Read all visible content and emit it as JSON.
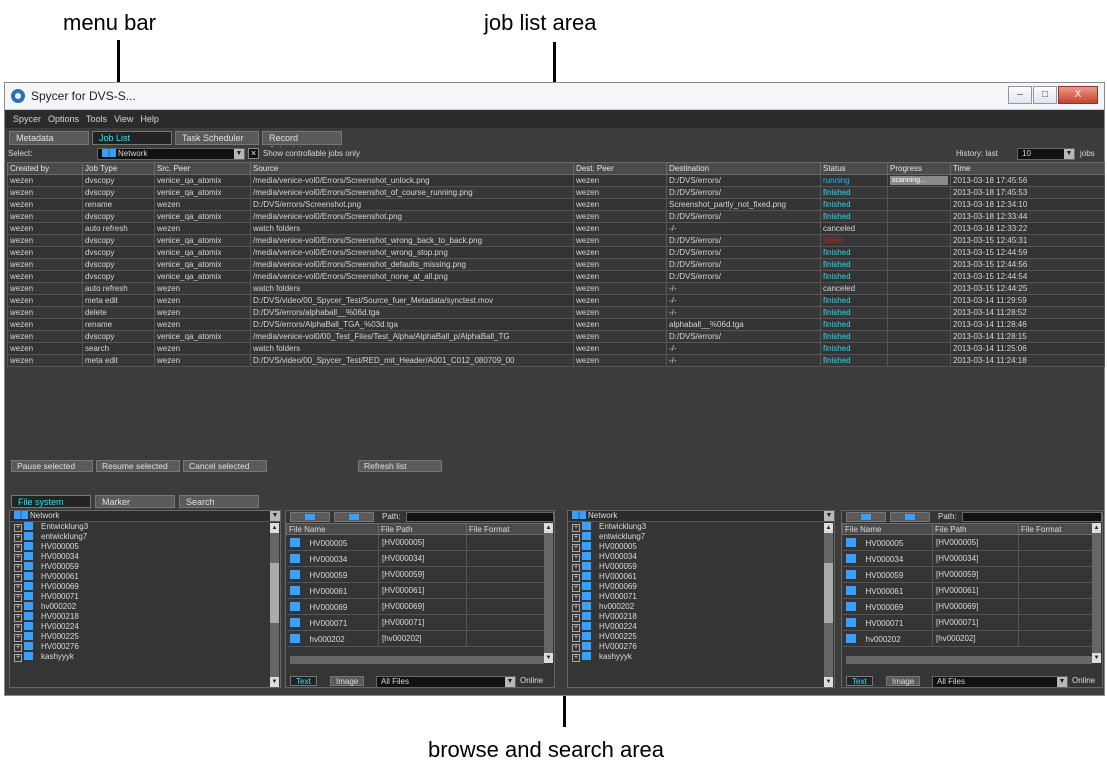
{
  "annotations": {
    "menu_bar": "menu bar",
    "job_list_area": "job list area",
    "browse_search_area": "browse and search area"
  },
  "window": {
    "title": "Spycer for DVS-S...",
    "buttons": [
      "–",
      "□",
      "X"
    ]
  },
  "menu": [
    "Spycer",
    "Options",
    "Tools",
    "View",
    "Help"
  ],
  "tabs": {
    "items": [
      "Metadata",
      "Job List",
      "Task Scheduler",
      "Record Scheduler"
    ],
    "active": "Job List"
  },
  "select_bar": {
    "label": "Select:",
    "network": "Network",
    "checkbox_label": "Show controllable jobs only",
    "checkbox_checked": true,
    "history_label": "History: last",
    "history_value": "10",
    "history_unit": "jobs"
  },
  "jobs": {
    "columns": [
      "Created by",
      "Job Type",
      "Src. Peer",
      "Source",
      "Dest. Peer",
      "Destination",
      "Status",
      "Progress",
      "Time"
    ],
    "rows": [
      [
        "wezen",
        "dvscopy",
        "venice_qa_atomix",
        "/media/venice-vol0/Errors/Screenshot_unlock.png",
        "wezen",
        "D:/DVS/errors/",
        "running",
        "scanning...",
        "2013-03-18 17:45:56"
      ],
      [
        "wezen",
        "dvscopy",
        "venice_qa_atomix",
        "/media/venice-vol0/Errors/Screenshot_of_course_running.png",
        "wezen",
        "D:/DVS/errors/",
        "finished",
        "",
        "2013-03-18 17:45:53"
      ],
      [
        "wezen",
        "rename",
        "wezen",
        "D:/DVS/errors/Screenshot.png",
        "wezen",
        "Screenshot_partly_not_fixed.png",
        "finished",
        "",
        "2013-03-18 12:34:10"
      ],
      [
        "wezen",
        "dvscopy",
        "venice_qa_atomix",
        "/media/venice-vol0/Errors/Screenshot.png",
        "wezen",
        "D:/DVS/errors/",
        "finished",
        "",
        "2013-03-18 12:33:44"
      ],
      [
        "wezen",
        "auto refresh",
        "wezen",
        "watch folders",
        "wezen",
        "-/-",
        "canceled",
        "",
        "2013-03-18 12:33:22"
      ],
      [
        "wezen",
        "dvscopy",
        "venice_qa_atomix",
        "/media/venice-vol0/Errors/Screenshot_wrong_back_to_back.png",
        "wezen",
        "D:/DVS/errors/",
        "failed",
        "",
        "2013-03-15 12:45:31"
      ],
      [
        "wezen",
        "dvscopy",
        "venice_qa_atomix",
        "/media/venice-vol0/Errors/Screenshot_wrong_stop.png",
        "wezen",
        "D:/DVS/errors/",
        "finished",
        "",
        "2013-03-15 12:44:59"
      ],
      [
        "wezen",
        "dvscopy",
        "venice_qa_atomix",
        "/media/venice-vol0/Errors/Screenshot_defaults_missing.png",
        "wezen",
        "D:/DVS/errors/",
        "finished",
        "",
        "2013-03-15 12:44:56"
      ],
      [
        "wezen",
        "dvscopy",
        "venice_qa_atomix",
        "/media/venice-vol0/Errors/Screenshot_none_at_all.png",
        "wezen",
        "D:/DVS/errors/",
        "finished",
        "",
        "2013-03-15 12:44:54"
      ],
      [
        "wezen",
        "auto refresh",
        "wezen",
        "watch folders",
        "wezen",
        "-/-",
        "canceled",
        "",
        "2013-03-15 12:44:25"
      ],
      [
        "wezen",
        "meta edit",
        "wezen",
        "D:/DVS/video/00_Spycer_Test/Source_fuer_Metadata/synctest.mov",
        "wezen",
        "-/-",
        "finished",
        "",
        "2013-03-14 11:29:59"
      ],
      [
        "wezen",
        "delete",
        "wezen",
        "D:/DVS/errors/alphaball__%06d.tga",
        "wezen",
        "-/-",
        "finished",
        "",
        "2013-03-14 11:28:52"
      ],
      [
        "wezen",
        "rename",
        "wezen",
        "D:/DVS/errors/AlphaBall_TGA_%03d.tga",
        "wezen",
        "alphaball__%06d.tga",
        "finished",
        "",
        "2013-03-14 11:28:46"
      ],
      [
        "wezen",
        "dvscopy",
        "venice_qa_atomix",
        "/media/venice-vol0/00_Test_Files/Test_Alpha/AlphaBall_p/AlphaBall_TG",
        "wezen",
        "D:/DVS/errors/",
        "finished",
        "",
        "2013-03-14 11:28:15"
      ],
      [
        "wezen",
        "search",
        "wezen",
        "watch folders",
        "wezen",
        "-/-",
        "finished",
        "",
        "2013-03-14 11:25:06"
      ],
      [
        "wezen",
        "meta edit",
        "wezen",
        "D:/DVS/video/00_Spycer_Test/RED_mit_Header/A001_C012_080709_00",
        "wezen",
        "-/-",
        "finished",
        "",
        "2013-03-14 11:24:18"
      ]
    ]
  },
  "actions": [
    "Pause selected",
    "Resume selected",
    "Cancel selected",
    "Refresh list"
  ],
  "browse_tabs": {
    "items": [
      "File system",
      "Marker",
      "Search"
    ],
    "active": "File system"
  },
  "tree": {
    "root": "Network",
    "nodes": [
      "Entwicklung3",
      "entwicklung7",
      "HV000005",
      "HV000034",
      "HV000059",
      "HV000061",
      "HV000069",
      "HV000071",
      "hv000202",
      "HV000218",
      "HV000224",
      "HV000225",
      "HV000276",
      "kashyyyk"
    ]
  },
  "files": {
    "path_label": "Path:",
    "columns": [
      "File Name",
      "File Path",
      "File Format"
    ],
    "rows": [
      [
        "HV000005",
        "[HV000005]",
        ""
      ],
      [
        "HV000034",
        "[HV000034]",
        ""
      ],
      [
        "HV000059",
        "[HV000059]",
        ""
      ],
      [
        "HV000061",
        "[HV000061]",
        ""
      ],
      [
        "HV000069",
        "[HV000069]",
        ""
      ],
      [
        "HV000071",
        "[HV000071]",
        ""
      ],
      [
        "hv000202",
        "[hv000202]",
        ""
      ]
    ],
    "view_tabs": [
      "Text",
      "Image"
    ],
    "filter": "All Files",
    "online_label": "Online"
  },
  "colors": {
    "finished": "#2ed8f0",
    "running": "#1eb8ff",
    "failed": "#c02020",
    "active_tab": "#2ee1ff"
  }
}
